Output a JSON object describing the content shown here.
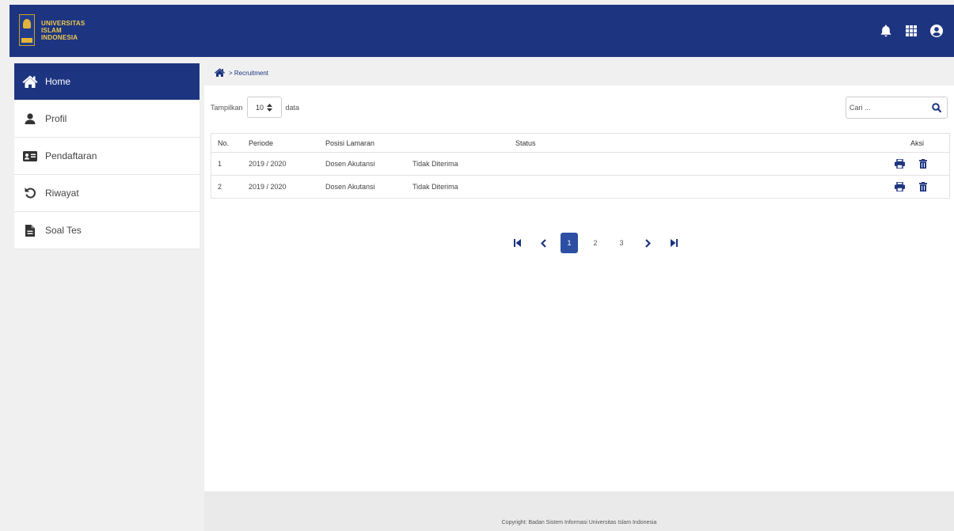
{
  "header": {
    "logo_lines": [
      "UNIVERSITAS",
      "ISLAM",
      "INDONESIA"
    ],
    "icons": [
      "bell-icon",
      "apps-grid-icon",
      "user-circle-icon"
    ],
    "color": "#1d3580"
  },
  "sidebar": {
    "items": [
      {
        "label": "Home",
        "icon": "home-icon",
        "active": true
      },
      {
        "label": "Profil",
        "icon": "user-icon",
        "active": false
      },
      {
        "label": "Pendaftaran",
        "icon": "id-card-icon",
        "active": false
      },
      {
        "label": "Riwayat",
        "icon": "history-icon",
        "active": false
      },
      {
        "label": "Soal Tes",
        "icon": "document-icon",
        "active": false
      }
    ]
  },
  "breadcrumb": {
    "icon": "home-icon",
    "text": "> Recruitment"
  },
  "controls": {
    "show_label": "Tampilkan",
    "page_size": "10",
    "data_label": "data",
    "search_placeholder": "Cari ..."
  },
  "table": {
    "columns": [
      "No.",
      "Periode",
      "Posisi Lamaran",
      "Status",
      "Aksi"
    ],
    "rows": [
      {
        "no": "1",
        "periode": "2019 / 2020",
        "posisi": "Dosen Akutansi",
        "status": "Tidak Diterima"
      },
      {
        "no": "2",
        "periode": "2019 / 2020",
        "posisi": "Dosen Akutansi",
        "status": "Tidak Diterima"
      }
    ]
  },
  "pagination": {
    "pages": [
      "1",
      "2",
      "3"
    ],
    "current": "1"
  },
  "footer": {
    "text": "Copyright: Badan Sistem Informasi Universitas Islam Indonesia"
  },
  "colors": {
    "primary": "#1d3580",
    "active_page": "#2c4fa4",
    "logo_gold": "#f2c94c"
  }
}
